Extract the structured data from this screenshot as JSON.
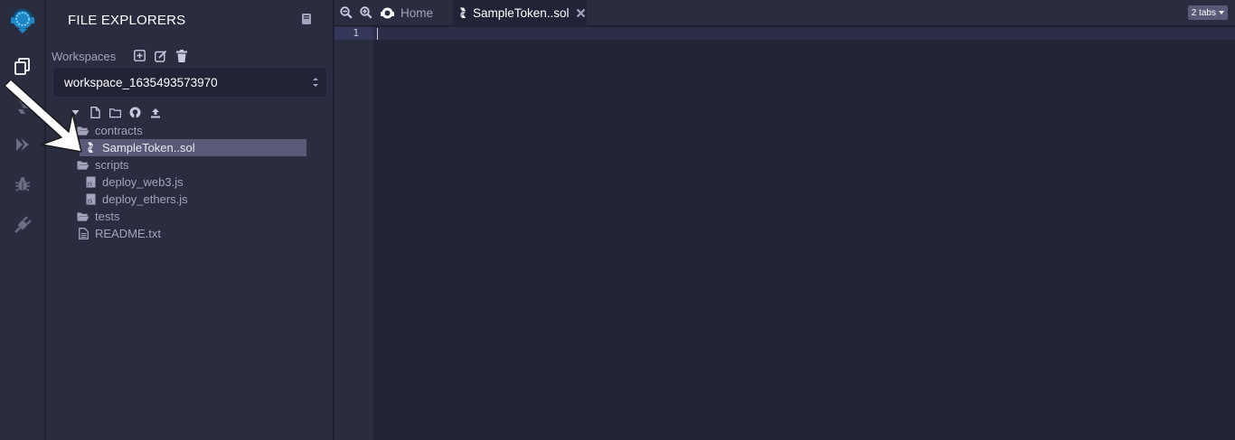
{
  "rail": {
    "items": [
      {
        "icon": "remix-logo-icon"
      },
      {
        "icon": "file-explorer-icon"
      },
      {
        "icon": "solidity-compiler-icon"
      },
      {
        "icon": "deploy-run-icon"
      },
      {
        "icon": "debugger-icon"
      },
      {
        "icon": "plugin-manager-icon"
      }
    ],
    "logo_color": "#1e88c7"
  },
  "panel": {
    "title": "FILE EXPLORERS",
    "workspaces_label": "Workspaces",
    "workspace_selected": "workspace_1635493573970",
    "tree": [
      {
        "label": "contracts",
        "type": "folder"
      },
      {
        "label": "SampleToken..sol",
        "type": "sol",
        "selected": true
      },
      {
        "label": "scripts",
        "type": "folder"
      },
      {
        "label": "deploy_web3.js",
        "type": "js"
      },
      {
        "label": "deploy_ethers.js",
        "type": "js"
      },
      {
        "label": "tests",
        "type": "folder"
      },
      {
        "label": "README.txt",
        "type": "txt"
      }
    ]
  },
  "tabs": {
    "home_label": "Home",
    "active_label": "SampleToken..sol",
    "count_label": "2 tabs"
  },
  "editor": {
    "line_numbers": [
      "1"
    ]
  },
  "colors": {
    "background": "#222336",
    "panel": "#2a2c3f",
    "selected": "#585a78",
    "text": "#a2a3bd",
    "accent": "#1e88c7"
  }
}
